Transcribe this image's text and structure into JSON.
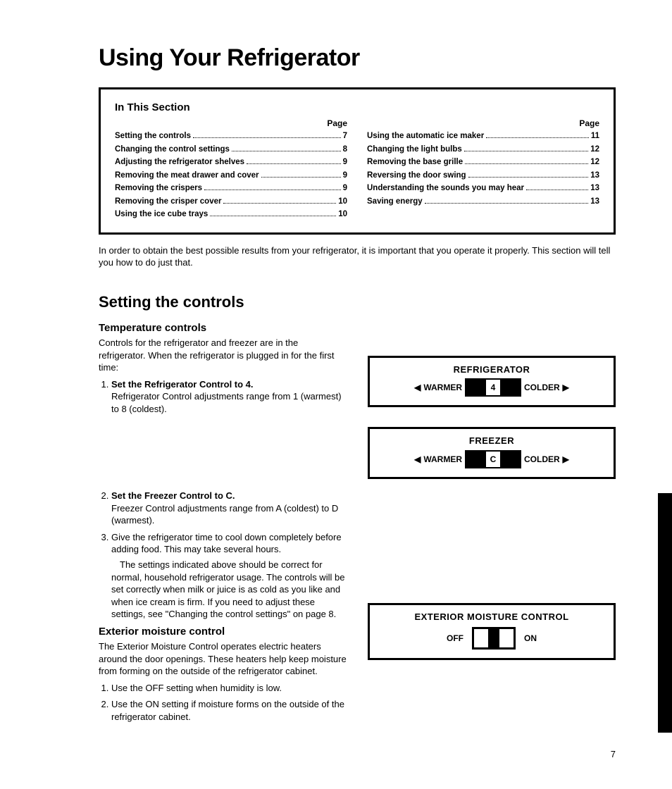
{
  "page_title": "Using Your Refrigerator",
  "toc": {
    "heading": "In This Section",
    "page_label": "Page",
    "left": [
      {
        "label": "Setting the controls",
        "pg": "7"
      },
      {
        "label": "Changing the control settings",
        "pg": "8"
      },
      {
        "label": "Adjusting the refrigerator shelves",
        "pg": "9"
      },
      {
        "label": "Removing the meat drawer and cover",
        "pg": "9"
      },
      {
        "label": "Removing the crispers",
        "pg": "9"
      },
      {
        "label": "Removing the crisper cover",
        "pg": "10"
      },
      {
        "label": "Using the ice cube trays",
        "pg": "10"
      }
    ],
    "right": [
      {
        "label": "Using the automatic ice maker",
        "pg": "11"
      },
      {
        "label": "Changing the light bulbs",
        "pg": "12"
      },
      {
        "label": "Removing the base grille",
        "pg": "12"
      },
      {
        "label": "Reversing the door swing",
        "pg": "13"
      },
      {
        "label": "Understanding the sounds you may hear",
        "pg": "13"
      },
      {
        "label": "Saving energy",
        "pg": "13"
      }
    ]
  },
  "intro": "In order to obtain the best possible results from your refrigerator, it is important that you operate it properly. This section will tell you how to do just that.",
  "section": {
    "heading": "Setting the controls",
    "sub1": {
      "heading": "Temperature controls",
      "lead": "Controls for the refrigerator and freezer are in the refrigerator. When the refrigerator is plugged in for the first time:",
      "step1_title": "Set the Refrigerator Control to 4.",
      "step1_body": "Refrigerator Control adjustments range from 1 (warmest) to 8 (coldest).",
      "step2_title": "Set the Freezer Control to C.",
      "step2_body": "Freezer Control adjustments range from A (coldest) to D (warmest).",
      "step3_body": "Give the refrigerator time to cool down completely before adding food. This may take several hours.",
      "note": "The settings indicated above should be correct for normal, household refrigerator usage. The controls will be set correctly when milk or juice is as cold as you like and when ice cream is firm. If you need to adjust these settings, see \"Changing the control settings\" on page 8."
    },
    "sub2": {
      "heading": "Exterior moisture control",
      "lead": "The Exterior Moisture Control operates electric heaters around the door openings. These heaters help keep moisture from forming on the outside of the refrigerator cabinet.",
      "step1": "Use the OFF setting when humidity is low.",
      "step2": "Use the ON setting if moisture forms on the outside of the refrigerator cabinet."
    }
  },
  "panels": {
    "fridge": {
      "title": "REFRIGERATOR",
      "warmer": "WARMER",
      "colder": "COLDER",
      "value": "4"
    },
    "freezer": {
      "title": "FREEZER",
      "warmer": "WARMER",
      "colder": "COLDER",
      "value": "C"
    },
    "moisture": {
      "title": "EXTERIOR MOISTURE CONTROL",
      "off": "OFF",
      "on": "ON"
    }
  },
  "page_number": "7"
}
